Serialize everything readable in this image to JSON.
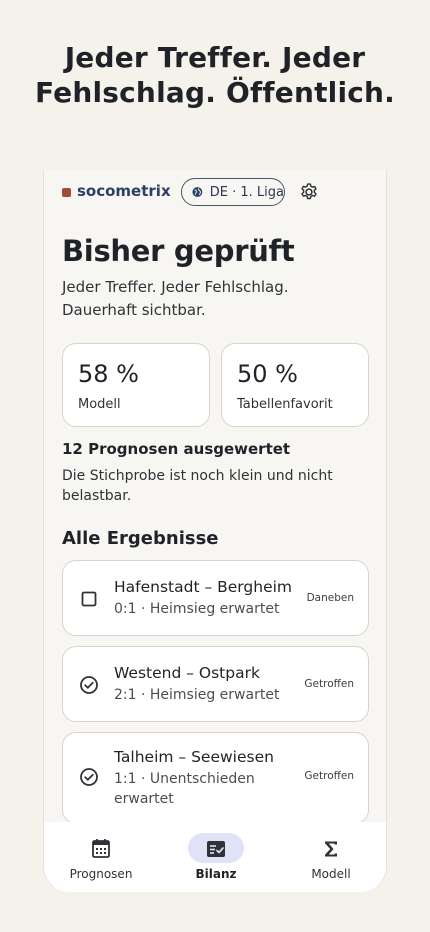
{
  "promo": {
    "headline_line1": "Jeder Treffer. Jeder",
    "headline_line2": "Fehlschlag. Öffentlich."
  },
  "app": {
    "brand": "socometrix",
    "league": "DE · 1. Liga",
    "icons": {
      "league": "globe-icon",
      "settings": "gear-icon"
    }
  },
  "page": {
    "title": "Bisher geprüft",
    "subtitle": "Jeder Treffer. Jeder Fehlschlag. Dauerhaft sichtbar."
  },
  "stats": [
    {
      "value": "58 %",
      "label": "Modell"
    },
    {
      "value": "50 %",
      "label": "Tabellenfavorit"
    }
  ],
  "evaluation": {
    "count_text": "12 Prognosen ausgewertet",
    "note": "Die Stichprobe ist noch klein und nicht belastbar."
  },
  "results": {
    "section_title": "Alle Ergebnisse",
    "items": [
      {
        "match": "Hafenstadt – Bergheim",
        "detail": "0:1 · Heimsieg erwartet",
        "status": "Daneben",
        "icon": "empty-checkbox-icon"
      },
      {
        "match": "Westend – Ostpark",
        "detail": "2:1 · Heimsieg erwartet",
        "status": "Getroffen",
        "icon": "check-circle-icon"
      },
      {
        "match": "Talheim – Seewiesen",
        "detail": "1:1 · Unentschieden erwartet",
        "status": "Getroffen",
        "icon": "check-circle-icon"
      }
    ]
  },
  "nav": {
    "items": [
      {
        "label": "Prognosen",
        "icon": "calendar-icon",
        "active": false
      },
      {
        "label": "Bilanz",
        "icon": "checklist-icon",
        "active": true
      },
      {
        "label": "Modell",
        "icon": "sigma-icon",
        "active": false
      }
    ]
  },
  "colors": {
    "background": "#f5f2eb",
    "brand_dot": "#a14b3b",
    "brand_text": "#2c3f66",
    "active_pill": "#dfe3f5"
  }
}
